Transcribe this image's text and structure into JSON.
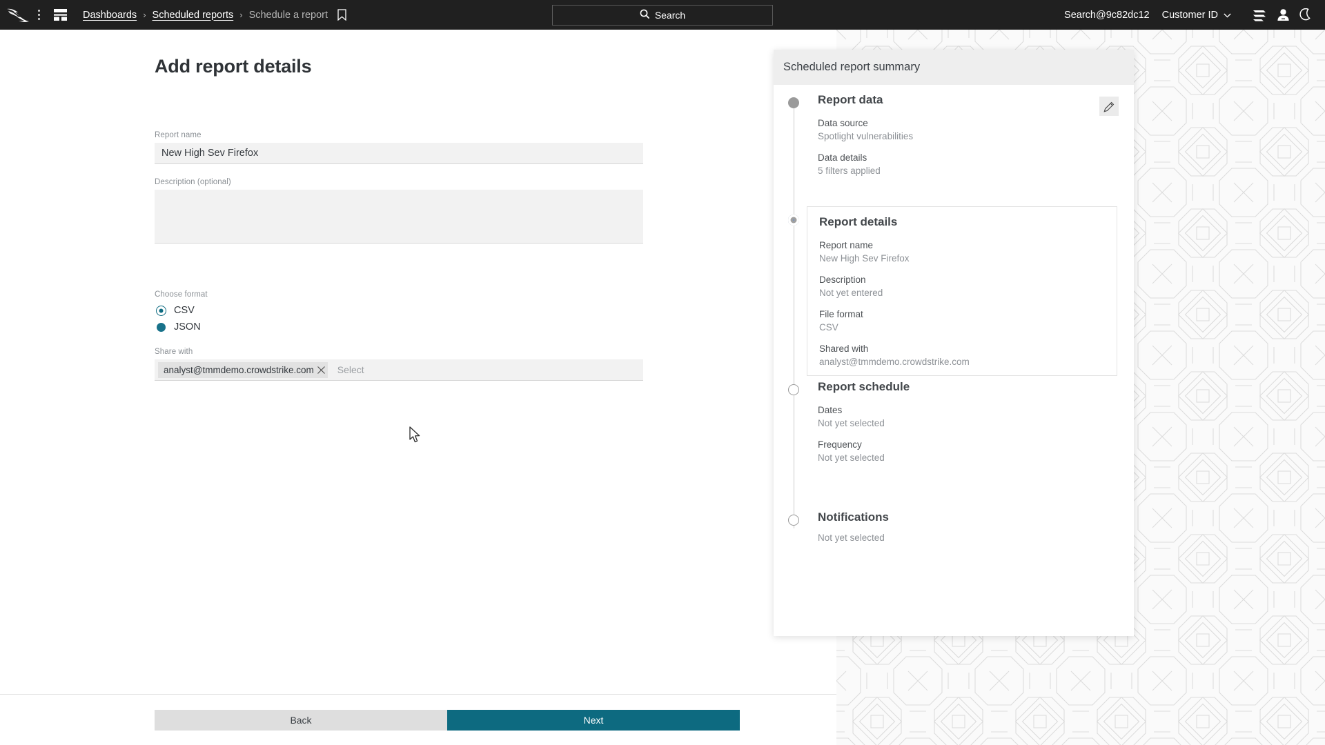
{
  "topbar": {
    "logo_icon": "crowdstrike-falcon-logo",
    "menu_icon": "kebab-menu-icon",
    "grid_icon": "dashboard-grid-icon",
    "breadcrumb": {
      "items": [
        {
          "label": "Dashboards",
          "link": true
        },
        {
          "label": "Scheduled reports",
          "link": true
        },
        {
          "label": "Schedule a report",
          "link": false
        }
      ],
      "separator": "›"
    },
    "bookmark_icon": "bookmark-icon",
    "search": {
      "label": "Search",
      "icon": "search-icon"
    },
    "account": "Search@9c82dc12",
    "customer_id": "Customer ID",
    "customer_id_chevron": "chevron-down-icon",
    "icons": [
      "layers-icon",
      "user-icon",
      "dark-mode-moon-icon"
    ],
    "bg": "#202020"
  },
  "main": {
    "title": "Add report details",
    "fields": {
      "report_name": {
        "label": "Report name",
        "value": "New High Sev Firefox",
        "placeholder": ""
      },
      "description": {
        "label": "Description (optional)",
        "value": "",
        "placeholder": ""
      },
      "format": {
        "label": "Choose format",
        "options": [
          {
            "label": "CSV",
            "state": "selected"
          },
          {
            "label": "JSON",
            "state": "filled"
          }
        ],
        "selected": "CSV"
      },
      "share_with": {
        "label": "Share with",
        "tokens": [
          {
            "label": "analyst@tmmdemo.crowdstrike.com",
            "remove_icon": "close-x-icon"
          }
        ],
        "placeholder": "Select"
      }
    }
  },
  "footer": {
    "back_label": "Back",
    "next_label": "Next"
  },
  "summary": {
    "header": "Scheduled report summary",
    "edit_icon": "pencil-edit-icon",
    "steps": [
      {
        "title": "Report data",
        "state": "done",
        "rows": [
          {
            "label": "Data source",
            "value": "Spotlight vulnerabilities"
          },
          {
            "label": "Data details",
            "value": "5 filters applied"
          }
        ]
      },
      {
        "title": "Report details",
        "state": "active",
        "rows": [
          {
            "label": "Report name",
            "value": "New High Sev Firefox"
          },
          {
            "label": "Description",
            "value": "Not yet entered"
          },
          {
            "label": "File format",
            "value": "CSV"
          },
          {
            "label": "Shared with",
            "value": "analyst@tmmdemo.crowdstrike.com"
          }
        ]
      },
      {
        "title": "Report schedule",
        "state": "todo",
        "rows": [
          {
            "label": "Dates",
            "value": "Not yet selected"
          },
          {
            "label": "Frequency",
            "value": "Not yet selected"
          }
        ]
      },
      {
        "title": "Notifications",
        "state": "todo",
        "rows": [
          {
            "label": "",
            "value": "Not yet selected"
          }
        ]
      }
    ]
  },
  "colors": {
    "accent_teal": "#0d6a80",
    "topbar_bg": "#202020",
    "active_step_blue": "#6e93c8",
    "field_bg": "#f2f2f2",
    "pattern_bg": "#fafafa"
  },
  "cursor": {
    "icon": "mouse-pointer-arrow"
  }
}
